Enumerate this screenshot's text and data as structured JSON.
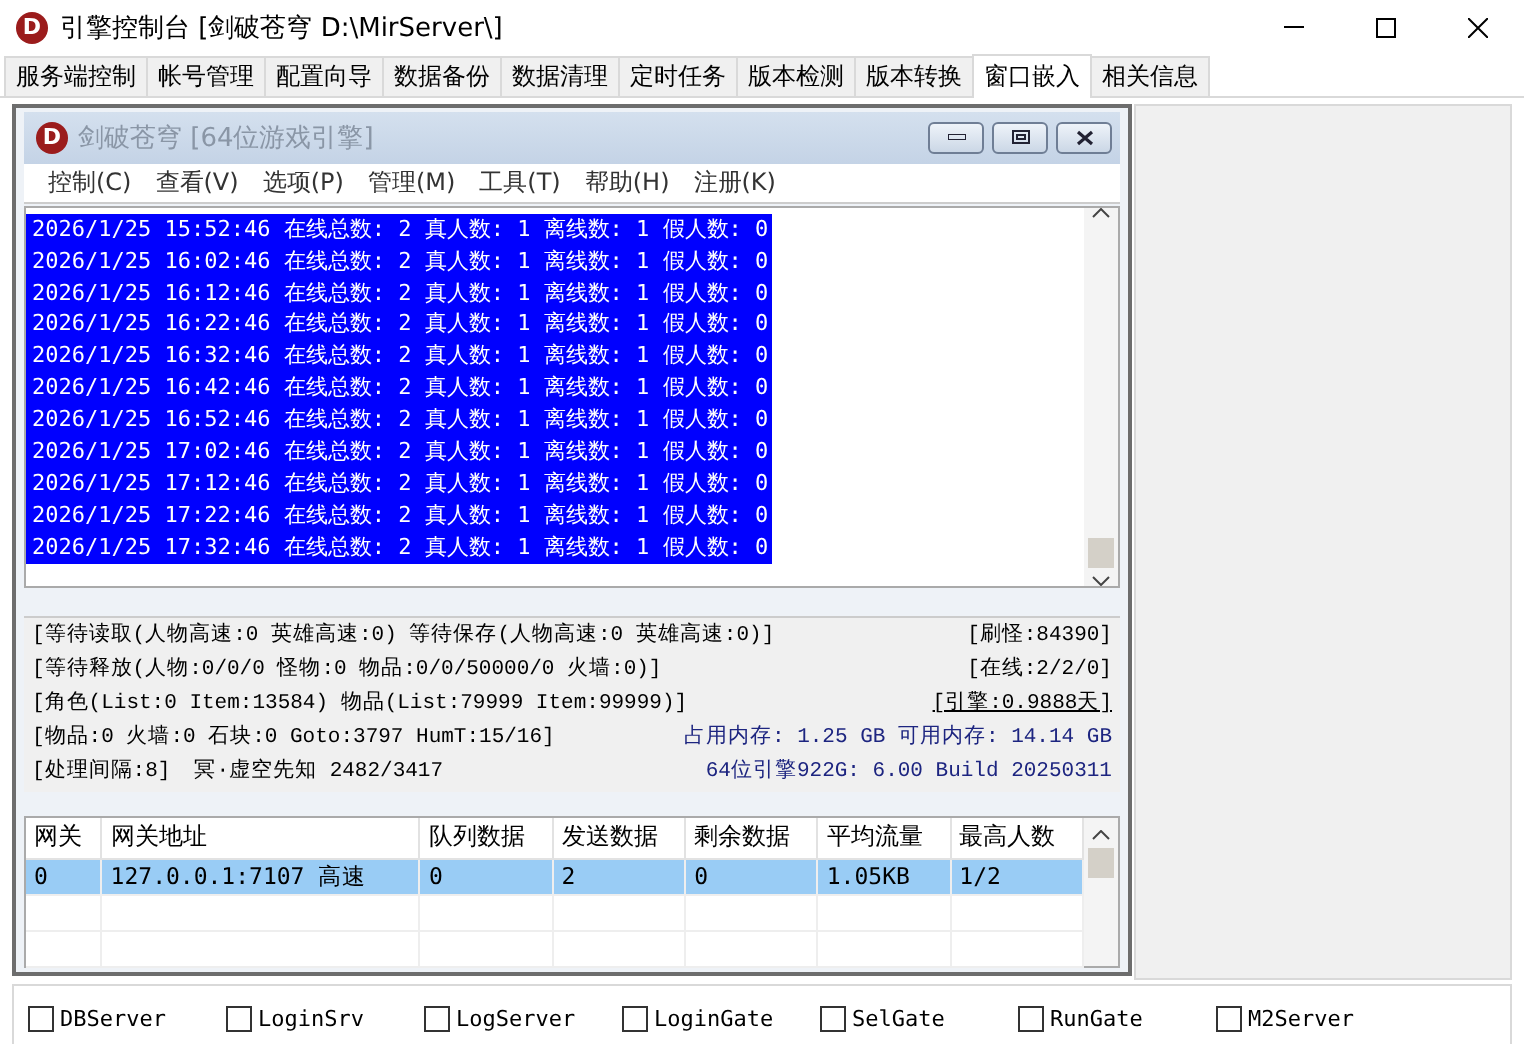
{
  "window": {
    "logo": "D",
    "title": "引擎控制台 [剑破苍穹 D:\\MirServer\\]"
  },
  "tabs": [
    {
      "label": "服务端控制",
      "selected": false
    },
    {
      "label": "帐号管理",
      "selected": false
    },
    {
      "label": "配置向导",
      "selected": false
    },
    {
      "label": "数据备份",
      "selected": false
    },
    {
      "label": "数据清理",
      "selected": false
    },
    {
      "label": "定时任务",
      "selected": false
    },
    {
      "label": "版本检测",
      "selected": false
    },
    {
      "label": "版本转换",
      "selected": false
    },
    {
      "label": "窗口嵌入",
      "selected": true
    },
    {
      "label": "相关信息",
      "selected": false
    }
  ],
  "inner_window": {
    "logo": "D",
    "title": "剑破苍穹 [64位游戏引擎]",
    "menu": [
      "控制(C)",
      "查看(V)",
      "选项(P)",
      "管理(M)",
      "工具(T)",
      "帮助(H)",
      "注册(K)"
    ],
    "log": {
      "selected": true,
      "lines": [
        "2026/1/25 15:52:46 在线总数: 2 真人数: 1 离线数: 1 假人数: 0",
        "2026/1/25 16:02:46 在线总数: 2 真人数: 1 离线数: 1 假人数: 0",
        "2026/1/25 16:12:46 在线总数: 2 真人数: 1 离线数: 1 假人数: 0",
        "2026/1/25 16:22:46 在线总数: 2 真人数: 1 离线数: 1 假人数: 0",
        "2026/1/25 16:32:46 在线总数: 2 真人数: 1 离线数: 1 假人数: 0",
        "2026/1/25 16:42:46 在线总数: 2 真人数: 1 离线数: 1 假人数: 0",
        "2026/1/25 16:52:46 在线总数: 2 真人数: 1 离线数: 1 假人数: 0",
        "2026/1/25 17:02:46 在线总数: 2 真人数: 1 离线数: 1 假人数: 0",
        "2026/1/25 17:12:46 在线总数: 2 真人数: 1 离线数: 1 假人数: 0",
        "2026/1/25 17:22:46 在线总数: 2 真人数: 1 离线数: 1 假人数: 0",
        "2026/1/25 17:32:46 在线总数: 2 真人数: 1 离线数: 1 假人数: 0"
      ]
    },
    "status": {
      "rows": [
        {
          "left": [
            "[等待读取(人物高速:0 英雄高速:0) 等待保存(人物高速:0 英雄高速:0)]"
          ],
          "right": "[刷怪:84390]",
          "kind": "plain"
        },
        {
          "left": [
            "[等待释放(人物:0/0/0 怪物:0 物品:0/0/50000/0 火墙:0)]"
          ],
          "right": "[在线:2/2/0]",
          "kind": "plain"
        },
        {
          "left": [
            "[角色(List:0 Item:13584) 物品(List:79999 Item:99999)]"
          ],
          "right": "[引擎:0.9888天]",
          "kind": "underlined"
        },
        {
          "left": [
            "[物品:0 火墙:0 石块:0 Goto:3797 HumT:15/16]"
          ],
          "right": "占用内存: 1.25 GB 可用内存: 14.14 GB",
          "kind": "info"
        },
        {
          "left": [
            "[处理间隔:8]",
            "冥·虚空先知 2482/3417"
          ],
          "right": "64位引擎922G: 6.00 Build 20250311",
          "kind": "info"
        }
      ]
    },
    "gateway_table": {
      "columns": [
        "网关",
        "网关地址",
        "队列数据",
        "发送数据",
        "剩余数据",
        "平均流量",
        "最高人数"
      ],
      "rows": [
        {
          "selected": true,
          "cells": [
            "0",
            "127.0.0.1:7107 高速",
            "0",
            "2",
            "0",
            "1.05KB",
            "1/2"
          ]
        }
      ]
    }
  },
  "servers": [
    {
      "label": "DBServer",
      "checked": false
    },
    {
      "label": "LoginSrv",
      "checked": false
    },
    {
      "label": "LogServer",
      "checked": false
    },
    {
      "label": "LoginGate",
      "checked": false
    },
    {
      "label": "SelGate",
      "checked": false
    },
    {
      "label": "RunGate",
      "checked": false
    },
    {
      "label": "M2Server",
      "checked": false
    }
  ]
}
